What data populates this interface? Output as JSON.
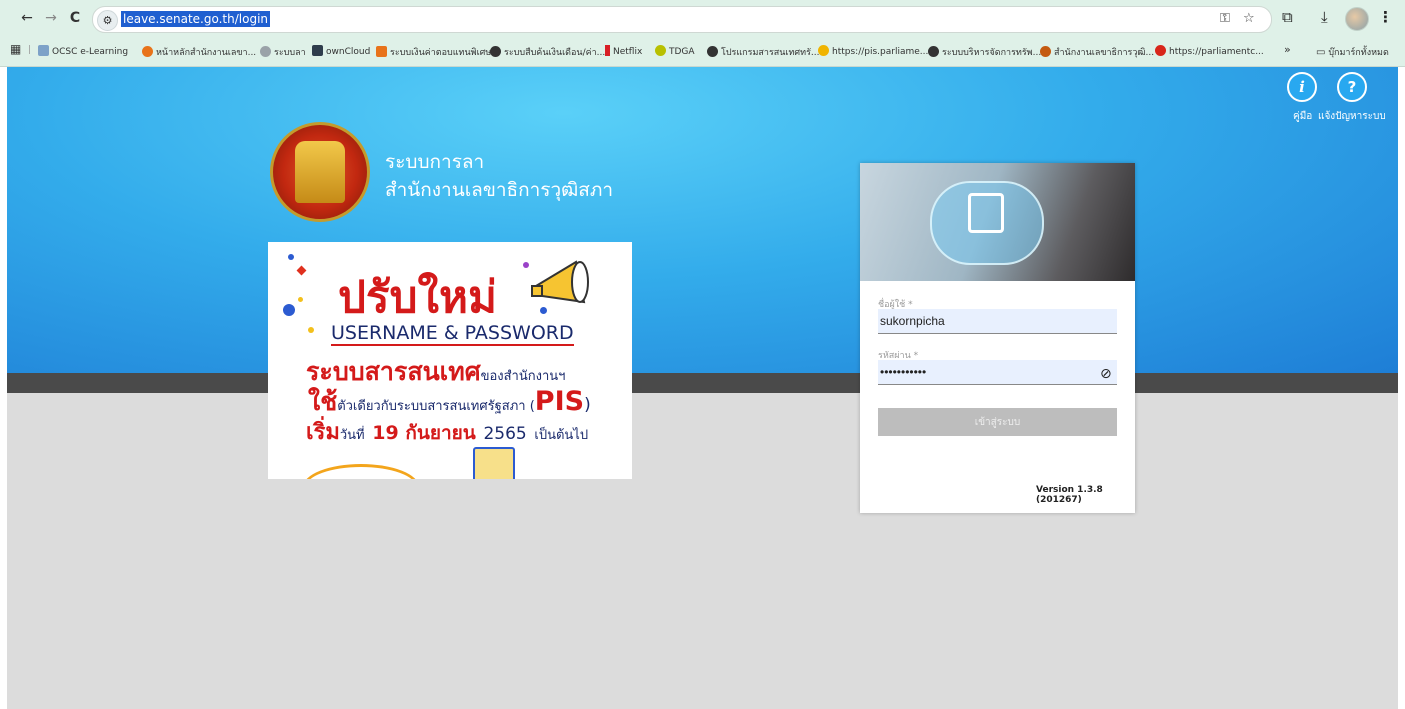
{
  "browser": {
    "url": "leave.senate.go.th/login",
    "back_icon": "←",
    "forward_icon": "→",
    "reload_icon": "C",
    "more_bookmarks": "»",
    "all_bookmarks": "บุ๊กมาร์กทั้งหมด",
    "bookmarks": [
      {
        "label": "OCSC e-Learning",
        "color": "#7da2c8"
      },
      {
        "label": "หน้าหลักสำนักงานเลขา...",
        "color": "#e8731a"
      },
      {
        "label": "ระบบลา",
        "color": "#9aa2a8"
      },
      {
        "label": "ownCloud",
        "color": "#2f3d4c"
      },
      {
        "label": "ระบบเงินค่าตอบแทนพิเศษ",
        "color": "#e8731a"
      },
      {
        "label": "ระบบสืบค้นเงินเดือน/ค่า...",
        "color": "#333333"
      },
      {
        "label": "Netflix",
        "color": "#d81f26"
      },
      {
        "label": "TDGA",
        "color": "#b8c000"
      },
      {
        "label": "โปรแกรมสารสนเทศทรั...",
        "color": "#333333"
      },
      {
        "label": "https://pis.parliame...",
        "color": "#f0b400"
      },
      {
        "label": "ระบบบริหารจัดการทรัพ...",
        "color": "#333333"
      },
      {
        "label": "สำนักงานเลขาธิการวุฒิ...",
        "color": "#c45a10"
      },
      {
        "label": "https://parliamentc...",
        "color": "#d8261a"
      }
    ]
  },
  "header": {
    "manual_label": "คู่มือ",
    "report_label": "แจ้งปัญหาระบบ",
    "system_title_line1": "ระบบการลา",
    "system_title_line2": "สำนักงานเลขาธิการวุฒิสภา"
  },
  "banner": {
    "headline": "ปรับใหม่",
    "line1": "USERNAME & PASSWORD",
    "line2_big": "ระบบสารสนเทศ",
    "line2_small": "ของสำนักงานฯ",
    "line3_big": "ใช้",
    "line3_small": "ตัวเดียวกับระบบสารสนเทศรัฐสภา (",
    "line3_pis": "PIS",
    "line3_end": ")",
    "line4_big": "เริ่ม",
    "line4_small": "วันที่",
    "line4_date": "19 กันยายน",
    "line4_year": "2565",
    "line4_end": "เป็นต้นไป"
  },
  "login": {
    "username_label": "ชื่อผู้ใช้ *",
    "username_value": "sukornpicha",
    "password_label": "รหัสผ่าน *",
    "password_value": "•••••••••••",
    "submit_label": "เข้าสู่ระบบ",
    "version": "Version 1.3.8 (201267)"
  },
  "colors": {
    "hero_top": "#5ad0f8",
    "hero_bottom": "#1e7ed6",
    "banner_red": "#d41a1a",
    "banner_navy": "#1a2a6c",
    "input_bg": "#e8f0fe"
  }
}
